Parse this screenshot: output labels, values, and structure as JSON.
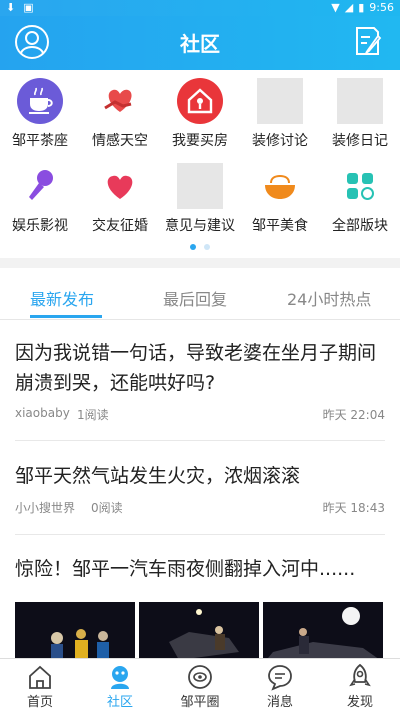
{
  "status_bar": {
    "time": "9:56",
    "left_icons": [
      "download-icon",
      "notification-icon"
    ],
    "right_icons": [
      "wifi-icon",
      "signal-icon",
      "battery-icon"
    ]
  },
  "header": {
    "title": "社区",
    "left_icon": "user-avatar-icon",
    "right_icon": "edit-note-icon"
  },
  "categories": [
    {
      "label": "邹平茶座",
      "icon": "tea-cup-icon",
      "color": "#6b5bd8"
    },
    {
      "label": "情感天空",
      "icon": "heart-hand-icon",
      "color": "#e84a4a"
    },
    {
      "label": "我要买房",
      "icon": "house-key-icon",
      "color": "#e9363a"
    },
    {
      "label": "装修讨论",
      "icon": "image-placeholder-icon"
    },
    {
      "label": "装修日记",
      "icon": "image-placeholder-icon"
    },
    {
      "label": "娱乐影视",
      "icon": "microphone-icon",
      "color": "#8a4de0"
    },
    {
      "label": "交友征婚",
      "icon": "hearts-icon",
      "color": "#e83a5a"
    },
    {
      "label": "意见与建议",
      "icon": "image-placeholder-icon"
    },
    {
      "label": "邹平美食",
      "icon": "noodle-bowl-icon",
      "color": "#f08a1c"
    },
    {
      "label": "全部版块",
      "icon": "all-blocks-icon",
      "color": "#27c2b4"
    }
  ],
  "pager": {
    "count": 2,
    "active": 0
  },
  "tabs": [
    {
      "label": "最新发布",
      "active": true
    },
    {
      "label": "最后回复",
      "active": false
    },
    {
      "label": "24小时热点",
      "active": false
    }
  ],
  "posts": [
    {
      "title": "因为我说错一句话，导致老婆在坐月子期间崩溃到哭，还能哄好吗?",
      "author": "xiaobaby",
      "reads": "1阅读",
      "time": "昨天 22:04"
    },
    {
      "title": "邹平天然气站发生火灾，浓烟滚滚",
      "author": "小小搜世界",
      "reads": "0阅读",
      "time": "昨天 18:43"
    },
    {
      "title": "惊险！邹平一汽车雨夜侧翻掉入河中......"
    }
  ],
  "bottom_nav": [
    {
      "label": "首页",
      "icon": "home-icon",
      "active": false
    },
    {
      "label": "社区",
      "icon": "community-icon",
      "active": true
    },
    {
      "label": "邹平圈",
      "icon": "circle-eye-icon",
      "active": false
    },
    {
      "label": "消息",
      "icon": "message-icon",
      "active": false
    },
    {
      "label": "发现",
      "icon": "rocket-icon",
      "active": false
    }
  ],
  "colors": {
    "accent": "#2aa6ef",
    "text": "#222222",
    "muted": "#888888"
  }
}
